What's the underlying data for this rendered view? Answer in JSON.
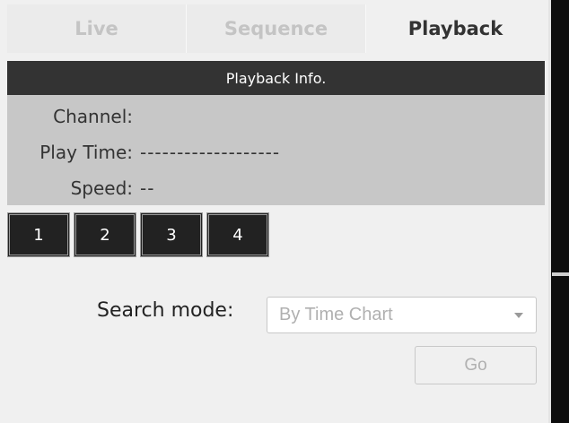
{
  "tabs": [
    {
      "label": "Live"
    },
    {
      "label": "Sequence"
    },
    {
      "label": "Playback"
    }
  ],
  "info": {
    "header": "Playback Info.",
    "rows": [
      {
        "label": "Channel:",
        "value": ""
      },
      {
        "label": "Play Time:",
        "value": "-------------------"
      },
      {
        "label": "Speed:",
        "value": "--"
      }
    ]
  },
  "channels": [
    {
      "label": "1"
    },
    {
      "label": "2"
    },
    {
      "label": "3"
    },
    {
      "label": "4"
    }
  ],
  "search": {
    "label": "Search mode:",
    "selected": "By Time Chart",
    "go_label": "Go"
  },
  "colors": {
    "header_bg": "#333333",
    "info_bg": "#c7c7c7",
    "channel_bg": "#222222"
  }
}
